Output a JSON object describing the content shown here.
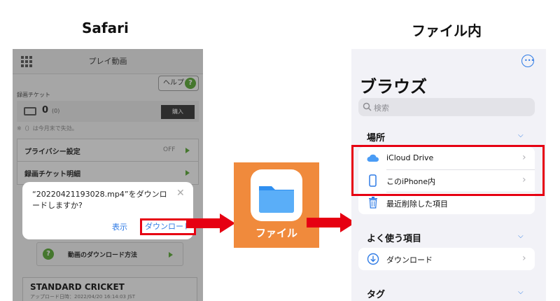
{
  "headings": {
    "left": "Safari",
    "right": "ファイル内"
  },
  "safari": {
    "header_title": "プレイ動画",
    "help_label": "ヘルプ",
    "help_glyph": "?",
    "ticket_label": "録画チケット",
    "ticket_count": "0",
    "ticket_sub": "(0)",
    "buy_label": "購入",
    "ticket_note": "※（）は今月末で失効。",
    "menu": [
      {
        "label": "プライバシー設定",
        "value": "OFF"
      },
      {
        "label": "録画チケット明細",
        "value": ""
      }
    ],
    "dialog": {
      "message": "“20220421193028.mp4”をダウンロードしますか?",
      "close": "✕",
      "show_label": "表示",
      "download_label": "ダウンロード"
    },
    "howto_glyph": "?",
    "howto_label": "動画のダウンロード方法",
    "card_title": "STANDARD CRICKET",
    "card_sub": "アップロード日時：2022/04/20 16:14:03 JST"
  },
  "files_app": {
    "label": "ファイル"
  },
  "browse": {
    "title": "ブラウズ",
    "search_placeholder": "検索",
    "sections": [
      {
        "header": "場所",
        "items": [
          {
            "label": "iCloud Drive",
            "icon": "cloud-icon"
          },
          {
            "label": "このiPhone内",
            "icon": "phone-icon"
          },
          {
            "label": "最近削除した項目",
            "icon": "trash-icon"
          }
        ]
      },
      {
        "header": "よく使う項目",
        "items": [
          {
            "label": "ダウンロード",
            "icon": "download-icon"
          }
        ]
      },
      {
        "header": "タグ",
        "items": []
      }
    ]
  },
  "colors": {
    "accent": "#2f7be5",
    "highlight": "#e60012",
    "files_tile": "#f08a3c",
    "help_green": "#57a832"
  }
}
